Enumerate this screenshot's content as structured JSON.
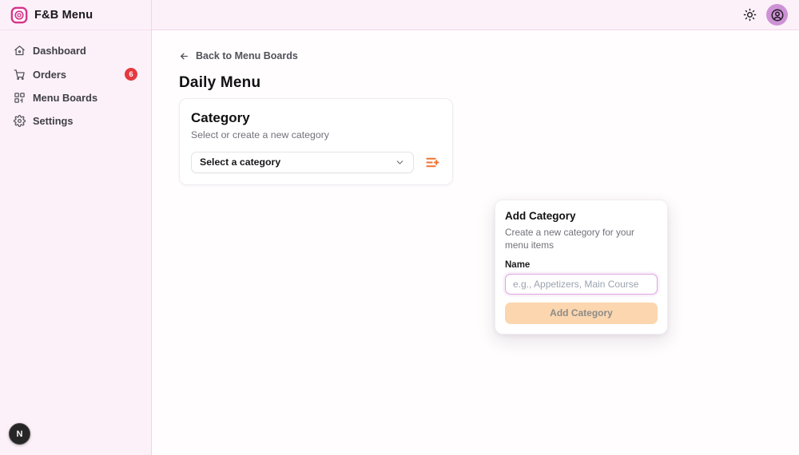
{
  "app": {
    "title": "F&B Menu"
  },
  "header": {
    "theme_toggle_icon": "sun-icon",
    "avatar_icon": "user-circle-icon"
  },
  "sidebar": {
    "items": [
      {
        "label": "Dashboard",
        "icon": "home-icon"
      },
      {
        "label": "Orders",
        "icon": "cart-icon",
        "badge": "6"
      },
      {
        "label": "Menu Boards",
        "icon": "grid-icon"
      },
      {
        "label": "Settings",
        "icon": "gear-icon"
      }
    ]
  },
  "main": {
    "back_link": "Back to Menu Boards",
    "page_title": "Daily Menu",
    "category_card": {
      "title": "Category",
      "subtitle": "Select or create a new category",
      "select_value": "Select a category"
    },
    "add_category_popover": {
      "title": "Add Category",
      "description": "Create a new category for your menu items",
      "name_label": "Name",
      "input_placeholder": "e.g., Appetizers, Main Course",
      "input_value": "",
      "submit_label": "Add Category"
    }
  },
  "dev_badge": "N",
  "colors": {
    "sidebar_bg": "#fdf1f9",
    "border_pink": "#f0d3e9",
    "accent_orange": "#ee7331",
    "badge_red": "#e5393f",
    "avatar_purple": "#cd92d6",
    "button_peach": "#fbd6af",
    "input_ring": "#dba7e0"
  }
}
